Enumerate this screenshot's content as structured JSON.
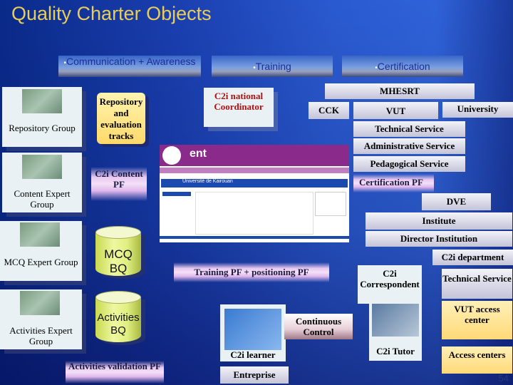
{
  "slide": {
    "title": "Quality Charter Objects",
    "page_number": "54"
  },
  "banners": {
    "communication": "Communication + Awareness",
    "training": "Training",
    "certification": "Certification",
    "bullet": "•"
  },
  "left_groups": [
    {
      "label": "Repository Group",
      "icon": "person-at-computer-photo"
    },
    {
      "label": "Content Expert Group",
      "icon": "person-at-computer-photo"
    },
    {
      "label": "MCQ Expert Group",
      "icon": "person-at-computer-photo"
    },
    {
      "label": "Activities Expert Group",
      "icon": "person-at-computer-photo"
    }
  ],
  "middle": {
    "repository_tracks": "Repository and evaluation tracks",
    "content_pf": "C2i Content PF",
    "mcq_bq_line1": "MCQ",
    "mcq_bq_line2": "BQ",
    "activities_bq_line1": "Activities",
    "activities_bq_line2": "BQ",
    "activities_validation": "Activities validation PF",
    "national_coordinator": "C2i national Coordinator",
    "training_pf": "Training PF + positioning PF",
    "learner": "C2i learner",
    "entreprise": "Entreprise",
    "continuous_control": "Continuous Control"
  },
  "right": {
    "mhesrt": "MHESRT",
    "cck": "CCK",
    "vut": "VUT",
    "university": "University",
    "technical_service": "Technical Service",
    "administrative_service": "Administrative Service",
    "pedagogical_service": "Pedagogical Service",
    "certification_pf": "Certification PF",
    "dve": "DVE",
    "institute": "Institute",
    "director_institution": "Director Institution",
    "c2i_department": "C2i department",
    "c2i_correspondent": "C2i Correspondent",
    "dept_technical_service": "Technical Service",
    "vut_access_center": "VUT access center",
    "c2i_tutor": "C2i Tutor",
    "access_centers": "Access centers"
  },
  "screenshot": {
    "logo_text": "ent",
    "banner_text": "Université de Kairouan",
    "colors": {
      "header": "#8a2a8a",
      "bar": "#1a4ab0"
    }
  }
}
